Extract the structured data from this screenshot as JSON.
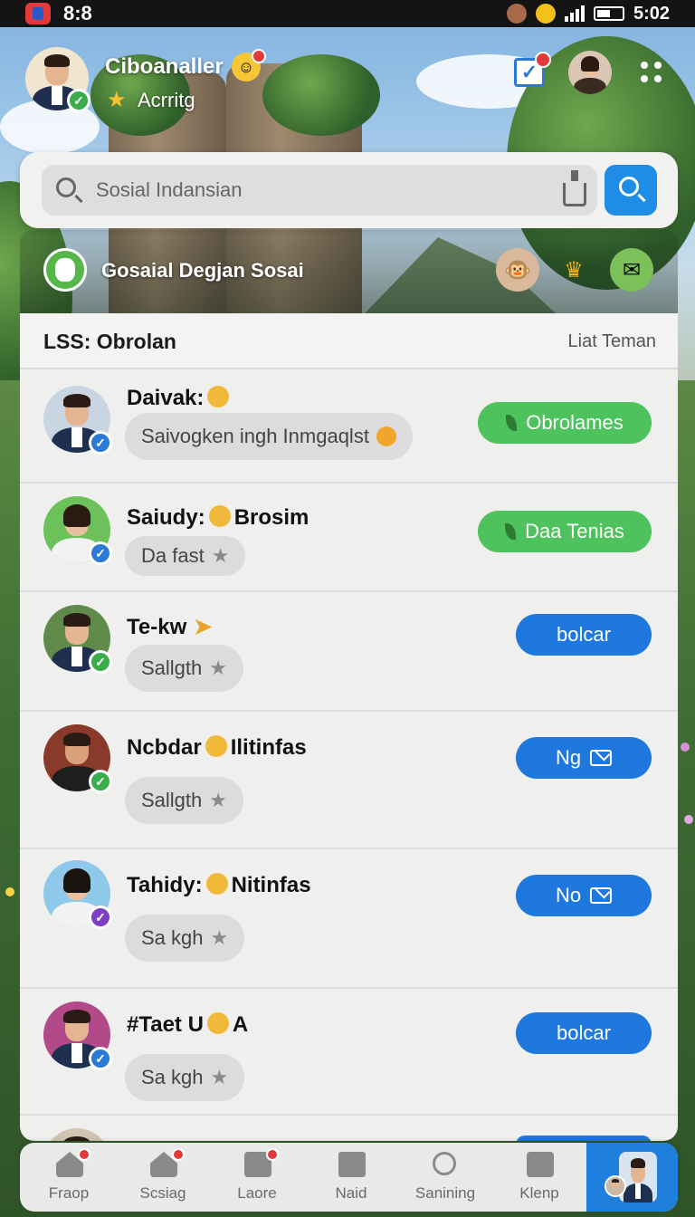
{
  "status_bar": {
    "time": "8:8",
    "clock": "5:02"
  },
  "header": {
    "name": "Ciboanaller",
    "status": "Acrritg"
  },
  "search": {
    "placeholder": "Sosial Indansian"
  },
  "group": {
    "title": "Gosaial Degjan Sosai"
  },
  "list": {
    "title": "LSS: Obrolan",
    "link": "Liat Teman",
    "rows": [
      {
        "name": "Daivak:",
        "message": "Saivogken ingh Inmgaqlst",
        "button": "Obrolames",
        "style": "green"
      },
      {
        "name": "Saiudy:",
        "name_suffix": "Brosim",
        "message": "Da fast",
        "button": "Daa Tenias",
        "style": "green"
      },
      {
        "name": "Te-kw",
        "message": "Sallgth",
        "button": "bolcar",
        "style": "blue"
      },
      {
        "name": "Ncbdar",
        "name_suffix": "Ilitinfas",
        "message": "Sallgth",
        "button": "Ng",
        "style": "blue"
      },
      {
        "name": "Tahidy:",
        "name_suffix": "Nitinfas",
        "message": "Sa kgh",
        "button": "No",
        "style": "blue"
      },
      {
        "name": "#Taet U",
        "name_suffix": "A",
        "message": "Sa kgh",
        "button": "bolcar",
        "style": "blue"
      }
    ]
  },
  "nav": {
    "items": [
      {
        "label": "Fraop",
        "icon": "home-icon"
      },
      {
        "label": "Scsiag",
        "icon": "home-icon"
      },
      {
        "label": "Laore",
        "icon": "building-icon"
      },
      {
        "label": "Naid",
        "icon": "mail-icon"
      },
      {
        "label": "Sanining",
        "icon": "search-icon"
      },
      {
        "label": "Klenp",
        "icon": "group-icon"
      }
    ]
  },
  "colors": {
    "accent_blue": "#1e78dd",
    "accent_green": "#4dc25d",
    "panel": "#efefee"
  }
}
